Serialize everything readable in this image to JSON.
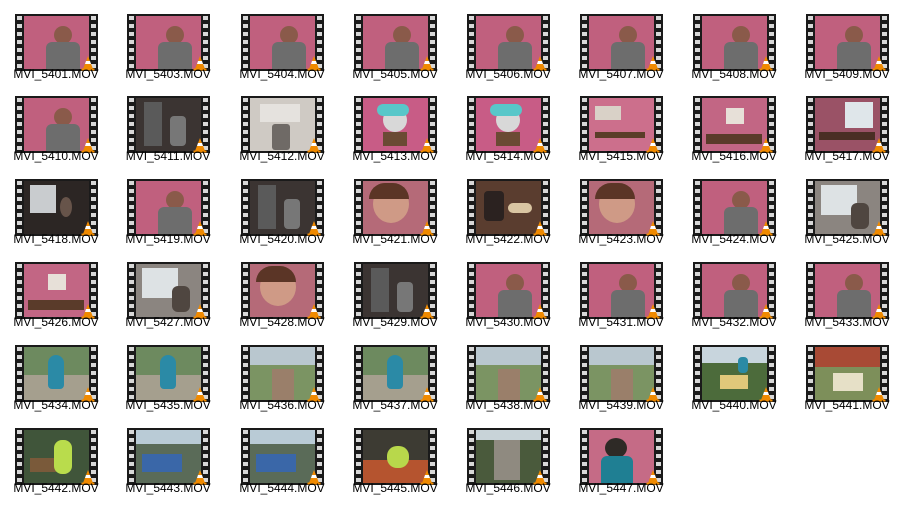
{
  "files": [
    {
      "name": "MVI_5401.MOV",
      "scene": "pink-person"
    },
    {
      "name": "MVI_5403.MOV",
      "scene": "pink-person"
    },
    {
      "name": "MVI_5404.MOV",
      "scene": "pink-person"
    },
    {
      "name": "MVI_5405.MOV",
      "scene": "pink-person"
    },
    {
      "name": "MVI_5406.MOV",
      "scene": "pink-person"
    },
    {
      "name": "MVI_5407.MOV",
      "scene": "pink-person"
    },
    {
      "name": "MVI_5408.MOV",
      "scene": "pink-person"
    },
    {
      "name": "MVI_5409.MOV",
      "scene": "pink-person"
    },
    {
      "name": "MVI_5410.MOV",
      "scene": "pink-person"
    },
    {
      "name": "MVI_5411.MOV",
      "scene": "room-dark"
    },
    {
      "name": "MVI_5412.MOV",
      "scene": "room-light"
    },
    {
      "name": "MVI_5413.MOV",
      "scene": "wig-head"
    },
    {
      "name": "MVI_5414.MOV",
      "scene": "wig-head"
    },
    {
      "name": "MVI_5415.MOV",
      "scene": "pink-shelf"
    },
    {
      "name": "MVI_5416.MOV",
      "scene": "pink-wall"
    },
    {
      "name": "MVI_5417.MOV",
      "scene": "window-pink"
    },
    {
      "name": "MVI_5418.MOV",
      "scene": "window-dark"
    },
    {
      "name": "MVI_5419.MOV",
      "scene": "pink-person"
    },
    {
      "name": "MVI_5420.MOV",
      "scene": "room-dark"
    },
    {
      "name": "MVI_5421.MOV",
      "scene": "closeup"
    },
    {
      "name": "MVI_5422.MOV",
      "scene": "desk-brown"
    },
    {
      "name": "MVI_5423.MOV",
      "scene": "closeup"
    },
    {
      "name": "MVI_5424.MOV",
      "scene": "pink-person"
    },
    {
      "name": "MVI_5425.MOV",
      "scene": "window-light"
    },
    {
      "name": "MVI_5426.MOV",
      "scene": "pink-wall"
    },
    {
      "name": "MVI_5427.MOV",
      "scene": "window-light"
    },
    {
      "name": "MVI_5428.MOV",
      "scene": "closeup"
    },
    {
      "name": "MVI_5429.MOV",
      "scene": "room-dark"
    },
    {
      "name": "MVI_5430.MOV",
      "scene": "pink-person"
    },
    {
      "name": "MVI_5431.MOV",
      "scene": "pink-person"
    },
    {
      "name": "MVI_5432.MOV",
      "scene": "pink-person"
    },
    {
      "name": "MVI_5433.MOV",
      "scene": "pink-person"
    },
    {
      "name": "MVI_5434.MOV",
      "scene": "park-blue"
    },
    {
      "name": "MVI_5435.MOV",
      "scene": "park-blue"
    },
    {
      "name": "MVI_5436.MOV",
      "scene": "park-path"
    },
    {
      "name": "MVI_5437.MOV",
      "scene": "park-blue"
    },
    {
      "name": "MVI_5438.MOV",
      "scene": "park-path"
    },
    {
      "name": "MVI_5439.MOV",
      "scene": "park-path"
    },
    {
      "name": "MVI_5440.MOV",
      "scene": "park-books"
    },
    {
      "name": "MVI_5441.MOV",
      "scene": "park-building"
    },
    {
      "name": "MVI_5442.MOV",
      "scene": "park-green"
    },
    {
      "name": "MVI_5443.MOV",
      "scene": "park-slide"
    },
    {
      "name": "MVI_5444.MOV",
      "scene": "park-slide"
    },
    {
      "name": "MVI_5445.MOV",
      "scene": "park-swing"
    },
    {
      "name": "MVI_5446.MOV",
      "scene": "park-stairs"
    },
    {
      "name": "MVI_5447.MOV",
      "scene": "pink-back"
    }
  ],
  "colors": {
    "film_border": "#1a1a1a",
    "cone_orange": "#f08a00",
    "cone_white": "#ffffff",
    "label_text": "#000000"
  },
  "icons": {
    "file_type_badge": "vlc-cone-icon",
    "thumbnail_frame": "filmstrip-icon"
  }
}
